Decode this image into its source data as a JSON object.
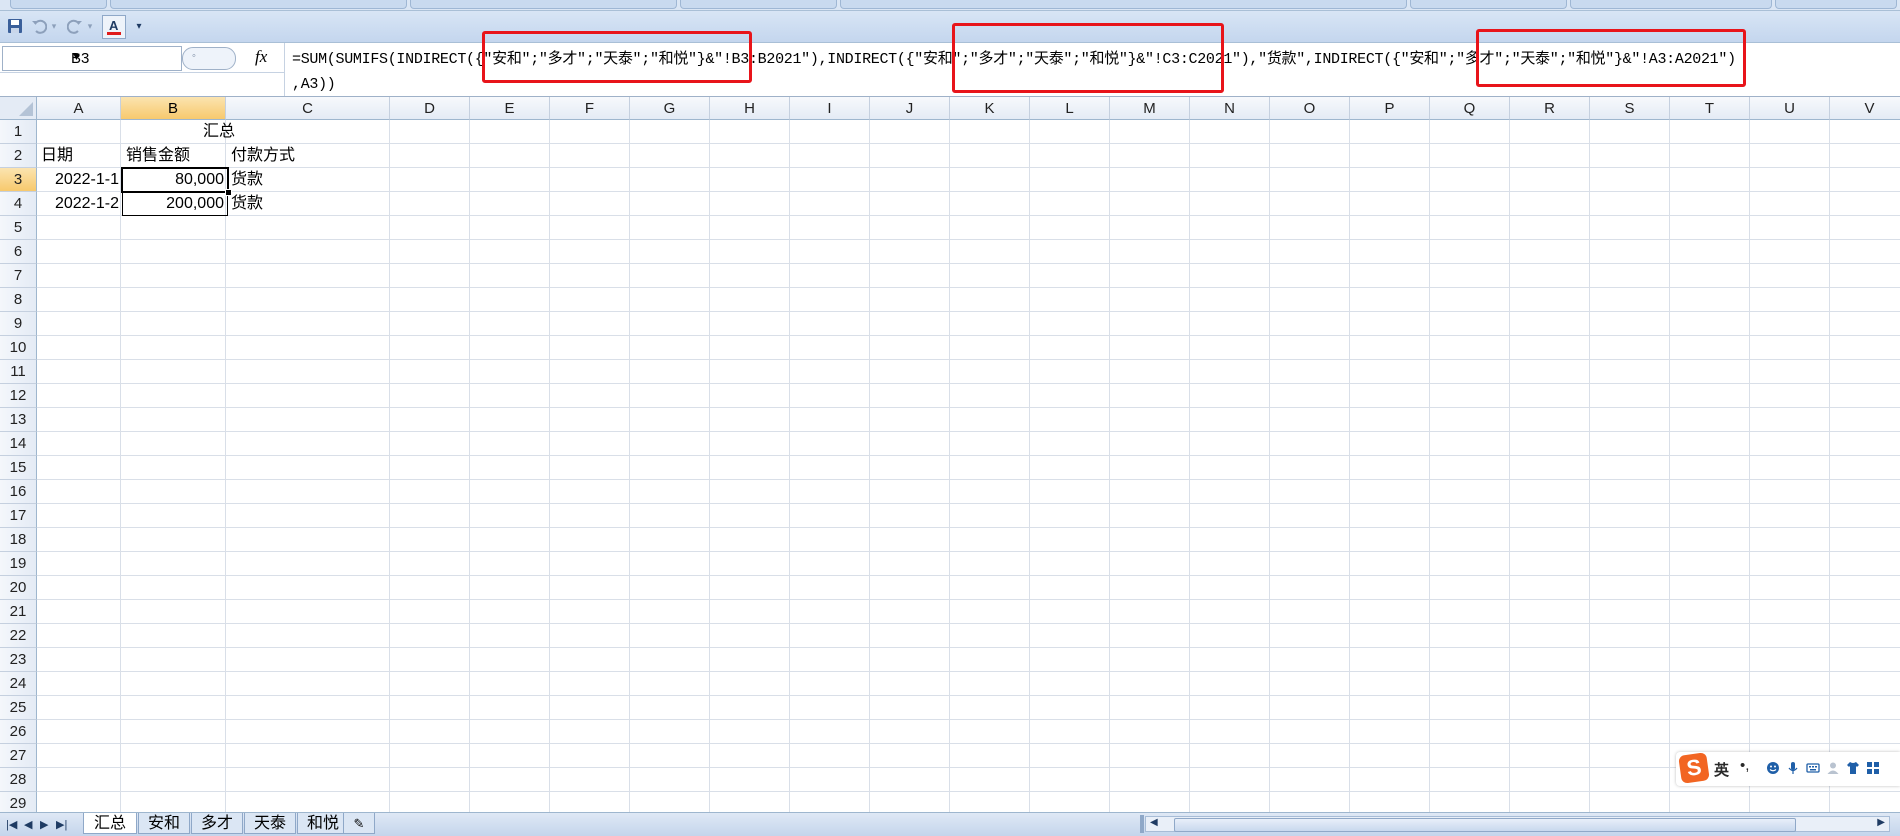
{
  "name_box": "B3",
  "fx_label": "fx",
  "formula_line1": "=SUM(SUMIFS(INDIRECT({\"安和\";\"多才\";\"天泰\";\"和悦\"}&\"!B3:B2021\"),INDIRECT({\"安和\";\"多才\";\"天泰\";\"和悦\"}&\"!C3:C2021\"),\"货款\",INDIRECT({\"安和\";\"多才\";\"天泰\";\"和悦\"}&\"!A3:A2021\")",
  "formula_line2": ",A3))",
  "columns": [
    "A",
    "B",
    "C",
    "D",
    "E",
    "F",
    "G",
    "H",
    "I",
    "J",
    "K",
    "L",
    "M",
    "N",
    "O",
    "P",
    "Q",
    "R",
    "S",
    "T",
    "U",
    "V"
  ],
  "selected_column": "B",
  "selected_row": "3",
  "rows": [
    "1",
    "2",
    "3",
    "4",
    "5",
    "6",
    "7",
    "8",
    "9",
    "10",
    "11",
    "12",
    "13",
    "14",
    "15",
    "16",
    "17",
    "18",
    "19",
    "20",
    "21",
    "22",
    "23",
    "24",
    "25",
    "26",
    "27",
    "28",
    "29"
  ],
  "cells": {
    "B1": "汇总",
    "A2": "日期",
    "B2": "销售金额",
    "C2": "付款方式",
    "A3": "2022-1-1",
    "B3": "80,000",
    "C3": "货款",
    "A4": "2022-1-2",
    "B4": "200,000",
    "C4": "货款"
  },
  "sheet_tabs": [
    "汇总",
    "安和",
    "多才",
    "天泰",
    "和悦"
  ],
  "active_sheet": "汇总",
  "ime": {
    "lang": "英",
    "punct": "•,"
  },
  "colors": {
    "highlight": "#e8141a",
    "header_selected": "#f7c96d",
    "ribbon": "#dbe6f4"
  }
}
